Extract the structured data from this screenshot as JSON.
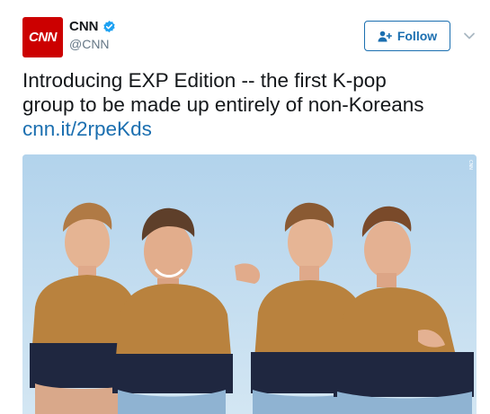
{
  "user": {
    "avatar_text": "CNN",
    "display_name": "CNN",
    "handle": "@CNN",
    "verified": true
  },
  "follow_button": {
    "label": "Follow",
    "icon": "add-person-icon"
  },
  "more_menu": {
    "icon": "chevron-down-icon"
  },
  "tweet": {
    "text_line1": "Introducing EXP Edition -- the first K-pop",
    "text_line2": "group to be made up entirely of non-Koreans",
    "link": "cnn.it/2rpeKds"
  },
  "photo": {
    "alt": "",
    "watermark": "CNN"
  },
  "colors": {
    "brand": "#cc0000",
    "link": "#1b6fb0",
    "sky": "#bcd9ee",
    "sweater_mustard": "#b9823e",
    "sweater_navy": "#1f2740",
    "shorts": "#8fb3d2"
  }
}
